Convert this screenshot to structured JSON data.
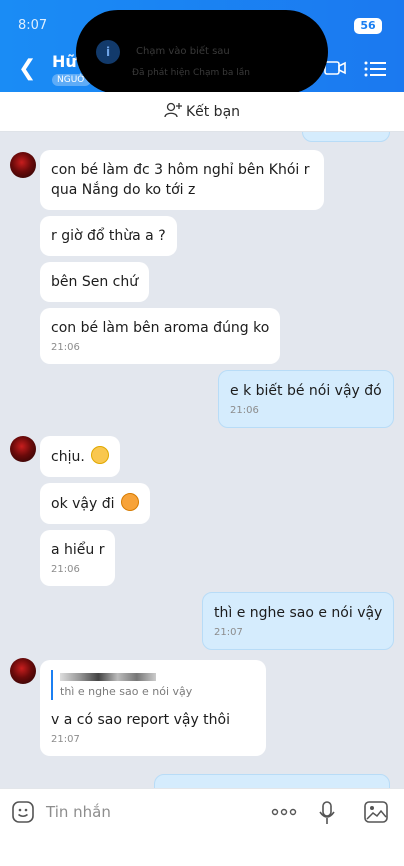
{
  "status": {
    "time": "8:07",
    "battery": "56"
  },
  "header": {
    "name": "Hữ",
    "tag": "NGUỜ"
  },
  "notification": {
    "title": "Chạm vào biết sau",
    "subtitle": "Đã phát hiện Chạm ba lần"
  },
  "friend_bar": {
    "label": "Kết bạn"
  },
  "messages": [
    {
      "text_1": "con bé làm đc 3 hôm nghỉ bên Khói r",
      "text_2": "qua Nắng do ko tới z"
    },
    {
      "text": "r giờ đổ thừa a ?"
    },
    {
      "text": "bên Sen chứ"
    },
    {
      "text": "con bé làm bên aroma đúng ko",
      "time": "21:06"
    },
    {
      "text": "e k biết bé nói vậy đó",
      "time": "21:06"
    },
    {
      "text": "chịu."
    },
    {
      "text": "ok vậy đi"
    },
    {
      "text": "a hiểu r",
      "time": "21:06"
    },
    {
      "text": "thì e nghe sao e nói vậy",
      "time": "21:07"
    },
    {
      "quote_name": "",
      "quote_text": "thì e nghe sao e nói vậy",
      "text": "v a có sao report vậy thôi",
      "time": "21:07"
    },
    {
      "text": "..."
    }
  ],
  "input": {
    "placeholder": "Tin nhắn"
  },
  "icons": [
    "back-icon",
    "video-call-icon",
    "menu-icon",
    "add-friend-icon",
    "emoji-icon",
    "more-icon",
    "mic-icon",
    "image-icon"
  ],
  "colors": {
    "header": "#1b7ff2",
    "outgoing_bubble": "#d5ecfd",
    "incoming_bubble": "#ffffff",
    "chat_bg": "#e3e7ee"
  }
}
